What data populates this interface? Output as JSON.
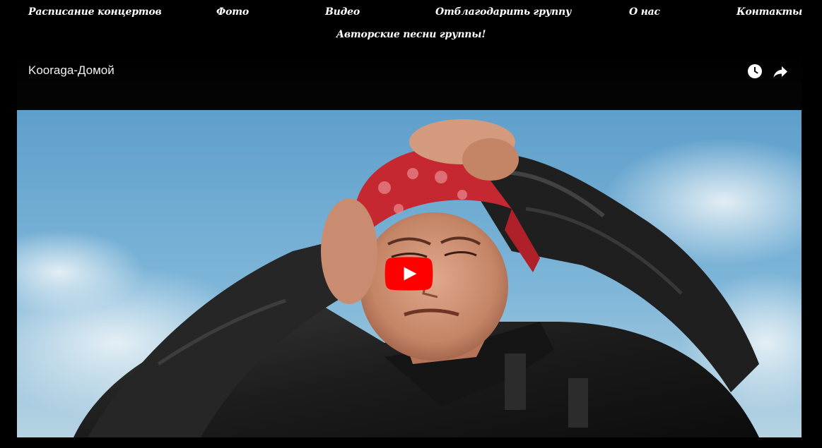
{
  "nav": {
    "items": [
      {
        "label": "Расписание концертов"
      },
      {
        "label": "Фото"
      },
      {
        "label": "Видео"
      },
      {
        "label": "Отблагодарить группу"
      },
      {
        "label": "О нас"
      },
      {
        "label": "Контакты"
      }
    ],
    "second_row": {
      "label": "Авторские песни группы!"
    }
  },
  "video": {
    "title": "Kooraga-Домой",
    "watch_later_icon": "clock-icon",
    "share_icon": "share-arrow-icon",
    "play_icon": "youtube-play-icon"
  },
  "colors": {
    "background": "#000000",
    "nav_text": "#ffffff",
    "title_text": "#f1f1f1",
    "play_red": "#ff0000",
    "sky": "#6fa9cf",
    "bandana": "#c62832",
    "jacket": "#1e1e1e"
  }
}
